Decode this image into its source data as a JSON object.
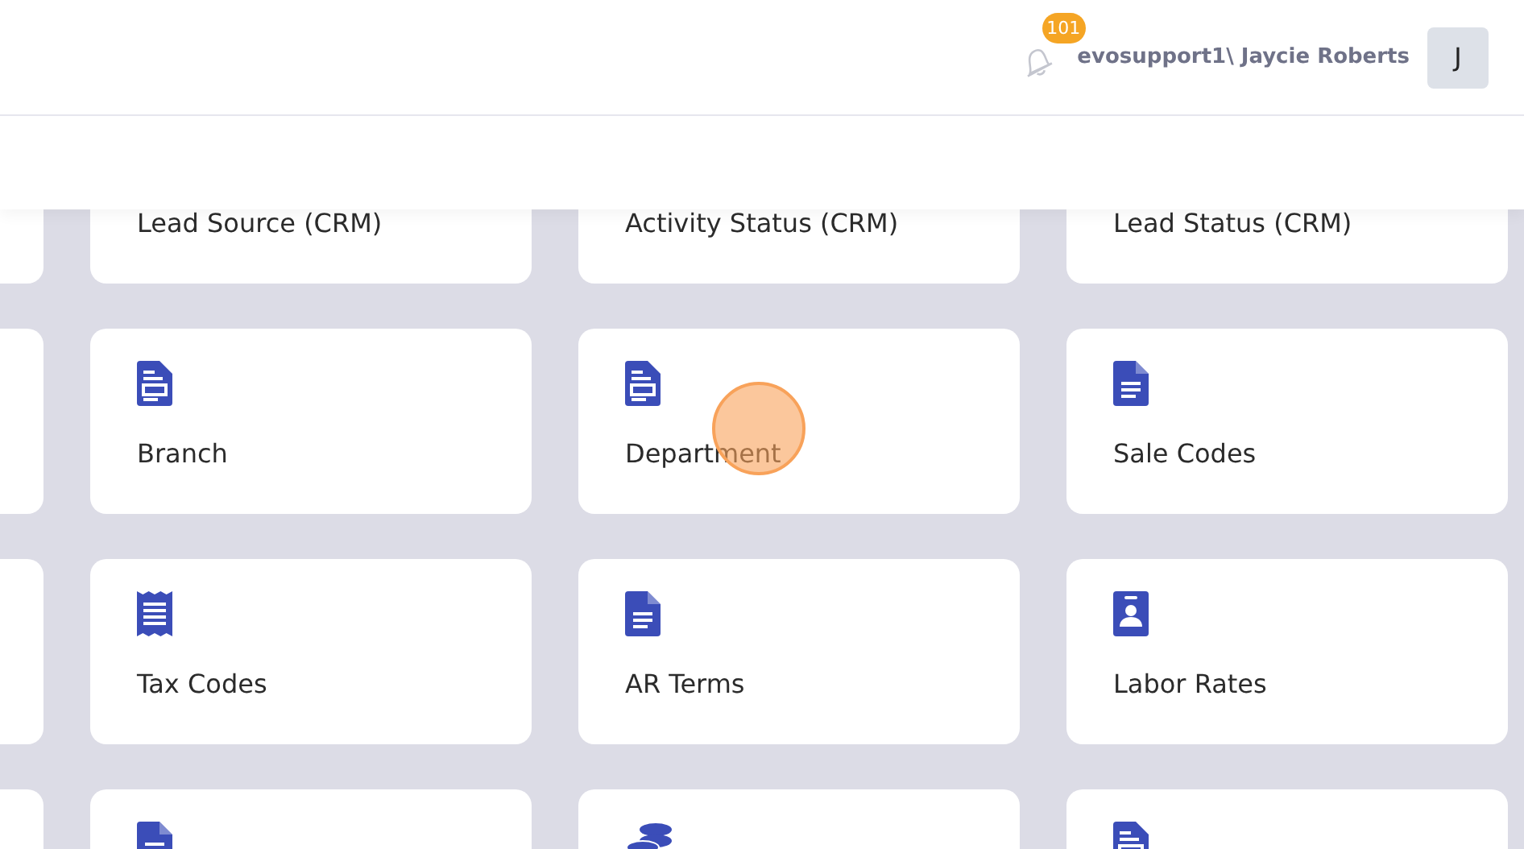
{
  "header": {
    "notification_count": "101",
    "user": "evosupport1\\ Jaycie Roberts",
    "avatar_initial": "J"
  },
  "cards": [
    {
      "label": "Lead Source (CRM)",
      "clicked": false
    },
    {
      "label": "Activity Status (CRM)",
      "clicked": false
    },
    {
      "label": "Lead Status (CRM)",
      "clicked": false
    },
    {
      "kind": "form",
      "label": "Branch",
      "clicked": false
    },
    {
      "kind": "form",
      "label": "Department",
      "clicked": true
    },
    {
      "kind": "doc",
      "label": "Sale Codes",
      "clicked": false
    },
    {
      "kind": "receipt",
      "label": "Tax Codes",
      "clicked": false
    },
    {
      "kind": "doc",
      "label": "AR Terms",
      "clicked": false
    },
    {
      "kind": "badge",
      "label": "Labor Rates",
      "clicked": false
    },
    {
      "kind": "doc",
      "clicked": false
    },
    {
      "kind": "coins",
      "clicked": false
    },
    {
      "kind": "form",
      "clicked": false
    }
  ]
}
